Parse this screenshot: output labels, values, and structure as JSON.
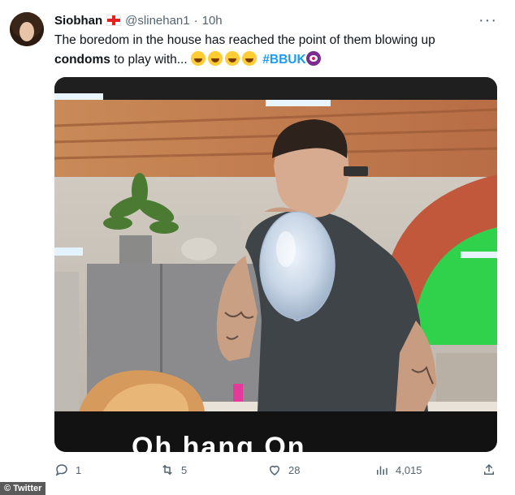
{
  "tweet": {
    "display_name": "Siobhan",
    "flag_icon": "england-flag-icon",
    "handle": "@slinehan1",
    "separator": "·",
    "time": "10h",
    "text_part1": "The boredom in the house has reached the point of them blowing up ",
    "text_bold": "condoms",
    "text_part2": " to play with... ",
    "emojis": [
      "rofl-emoji",
      "rofl-emoji",
      "rofl-emoji",
      "rofl-emoji"
    ],
    "hashtag": "#BBUK",
    "hashtag_emoji": "eye-emoji",
    "more_label": "···"
  },
  "media": {
    "overlay_text": "Oh hang On"
  },
  "actions": {
    "replies": "1",
    "retweets": "5",
    "likes": "28",
    "views": "4,015"
  },
  "credit": "© Twitter",
  "colors": {
    "link": "#1d9bf0",
    "secondary_text": "#536471",
    "primary_text": "#0f1419"
  }
}
